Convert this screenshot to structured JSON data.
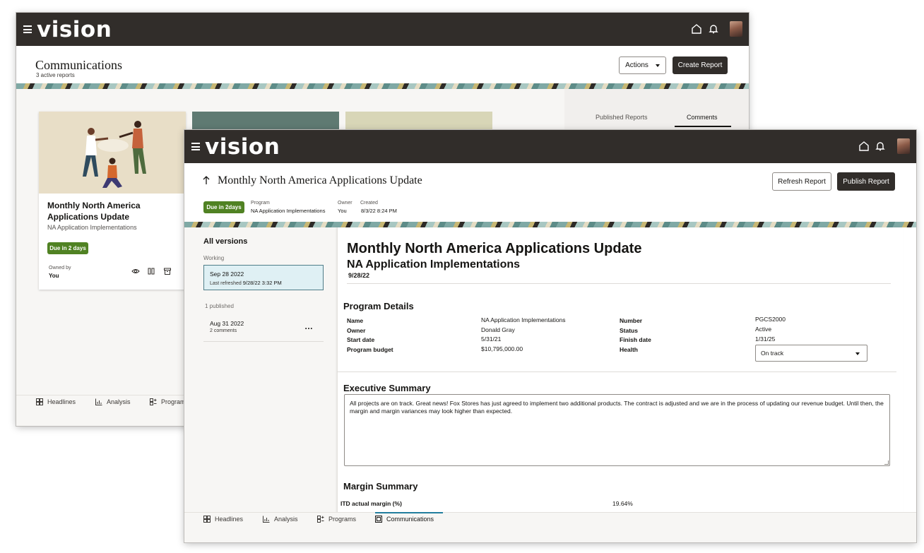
{
  "back_window": {
    "brand": "vision",
    "page_title": "Communications",
    "page_subtitle": "3 active reports",
    "actions_label": "Actions",
    "create_label": "Create Report",
    "side_tabs": [
      "Published Reports",
      "Comments"
    ],
    "card": {
      "title": "Monthly North America Applications Update",
      "subtitle": "NA Application Implementations",
      "badge": "Due in 2 days",
      "owned_by_label": "Owned by",
      "owned_by_value": "You"
    },
    "nav": [
      "Headlines",
      "Analysis",
      "Program"
    ]
  },
  "front_window": {
    "brand": "vision",
    "title": "Monthly North America Applications Update",
    "refresh_label": "Refresh Report",
    "publish_label": "Publish Report",
    "badge": "Due in 2days",
    "meta": {
      "program_label": "Program",
      "program_value": "NA Application Implementations",
      "owner_label": "Owner",
      "owner_value": "You",
      "created_label": "Created",
      "created_value": "8/3/22 8:24 PM"
    },
    "versions": {
      "heading": "All versions",
      "working_label": "Working",
      "working_date": "Sep 28 2022",
      "working_refreshed_label": "Last refreshed",
      "working_refreshed_value": "9/28/22 3:32 PM",
      "published_label": "1 published",
      "published_date": "Aug 31 2022",
      "published_comments": "2 comments"
    },
    "report": {
      "heading": "Monthly North America Applications Update",
      "subheading": "NA Application Implementations",
      "date": "9/28/22",
      "program_details_title": "Program Details",
      "details_left": [
        {
          "label": "Name",
          "value": "NA Application Implementations"
        },
        {
          "label": "Owner",
          "value": "Donald Gray"
        },
        {
          "label": "Start date",
          "value": "5/31/21"
        },
        {
          "label": "Program budget",
          "value": "$10,795,000.00"
        }
      ],
      "details_right": [
        {
          "label": "Number",
          "value": "PGCS2000"
        },
        {
          "label": "Status",
          "value": "Active"
        },
        {
          "label": "Finish date",
          "value": "1/31/25"
        },
        {
          "label": "Health",
          "value": "On track"
        }
      ],
      "executive_summary_title": "Executive Summary",
      "executive_summary_text": "All projects are on track. Great news! Fox Stores has just agreed to implement two additional products. The contract is adjusted and we are in the process of updating our revenue budget. Until then, the margin and margin variances may look higher than expected.",
      "margin_summary_title": "Margin Summary",
      "margin_label": "ITD actual margin (%)",
      "margin_value": "19.64%"
    },
    "nav": [
      "Headlines",
      "Analysis",
      "Programs",
      "Communications"
    ]
  }
}
